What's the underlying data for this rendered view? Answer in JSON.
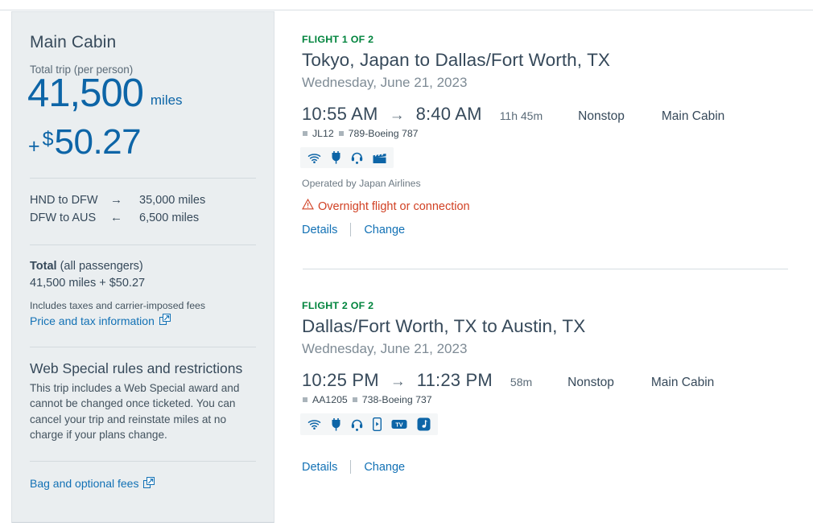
{
  "sidebar": {
    "cabin_title": "Main Cabin",
    "total_trip_label": "Total trip (per person)",
    "miles_amount": "41,500",
    "miles_unit": "miles",
    "plus_sign": "+",
    "dollar_sign": "$",
    "money_amount": "50.27",
    "legs": [
      {
        "route": "HND to DFW",
        "arrow": "→",
        "miles": "35,000 miles"
      },
      {
        "route": "DFW to AUS",
        "arrow": "←",
        "miles": "6,500 miles"
      }
    ],
    "total_bold": "Total",
    "total_rest": " (all passengers)",
    "total_value": "41,500 miles + $50.27",
    "taxes_note": "Includes taxes and carrier-imposed fees",
    "price_tax_link": "Price and tax information",
    "rules_title": "Web Special rules and restrictions",
    "rules_body": "This trip includes a Web Special award and cannot be changed once ticketed. You can cancel your trip and reinstate miles at no charge if your plans change.",
    "bag_fees_link": "Bag and optional fees"
  },
  "flights": [
    {
      "eyebrow": "FLIGHT 1 OF 2",
      "route": "Tokyo, Japan to Dallas/Fort Worth, TX",
      "date": "Wednesday, June 21, 2023",
      "depart_time": "10:55 AM",
      "arrow": "→",
      "arrive_time": "8:40 AM",
      "duration": "11h 45m",
      "stops": "Nonstop",
      "cabin": "Main Cabin",
      "flight_number": "JL12",
      "equipment": "789-Boeing 787",
      "amenities": [
        "wifi-icon",
        "power-outlet-icon",
        "headset-icon",
        "movie-icon"
      ],
      "operated_by": "Operated by Japan Airlines",
      "warning": "Overnight flight or connection",
      "details_link": "Details",
      "change_link": "Change"
    },
    {
      "eyebrow": "FLIGHT 2 OF 2",
      "route": "Dallas/Fort Worth, TX to Austin, TX",
      "date": "Wednesday, June 21, 2023",
      "depart_time": "10:25 PM",
      "arrow": "→",
      "arrive_time": "11:23 PM",
      "duration": "58m",
      "stops": "Nonstop",
      "cabin": "Main Cabin",
      "flight_number": "AA1205",
      "equipment": "738-Boeing 737",
      "amenities": [
        "wifi-icon",
        "power-outlet-icon",
        "headset-icon",
        "device-streaming-icon",
        "tv-icon",
        "music-icon"
      ],
      "operated_by": "",
      "warning": "",
      "details_link": "Details",
      "change_link": "Change"
    }
  ],
  "colors": {
    "brand_blue": "#0d65a7",
    "link_blue": "#1271b5",
    "flight_green": "#00843d",
    "warning_red": "#d14124",
    "sidebar_bg": "#eaeef0",
    "text_slate": "#36495a"
  }
}
